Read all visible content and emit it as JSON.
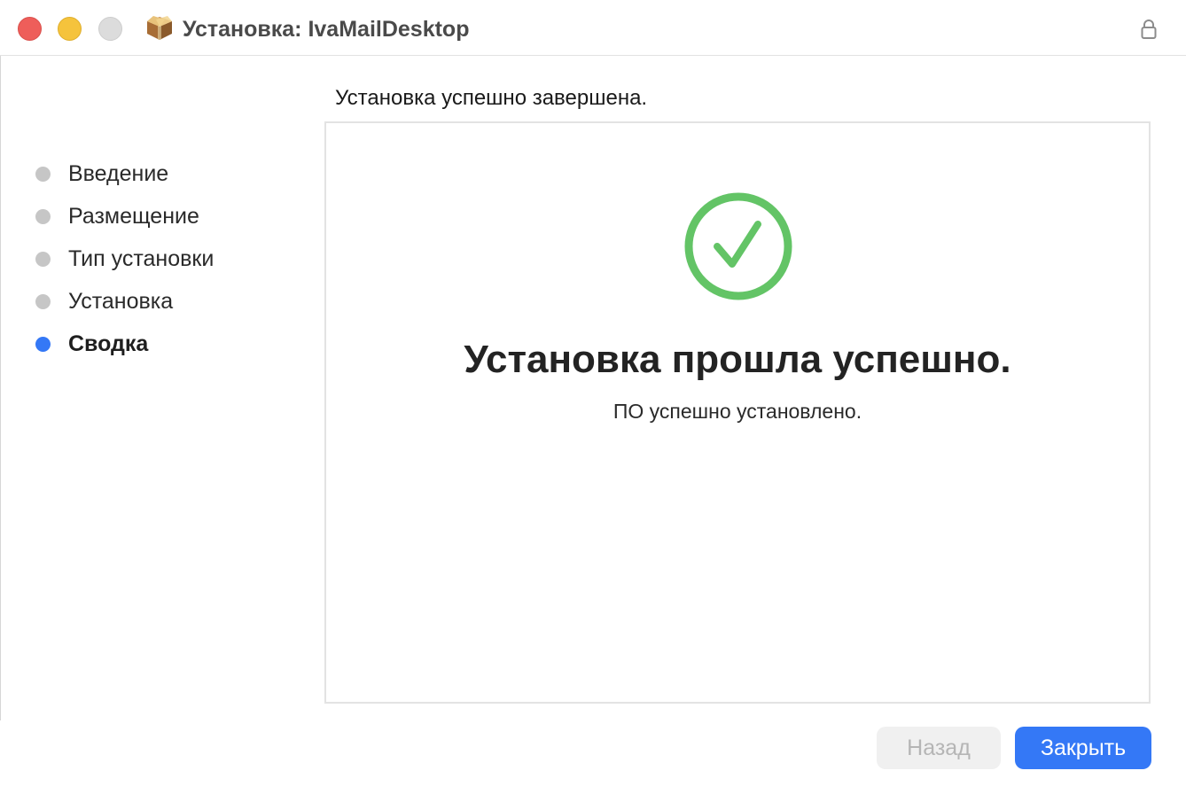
{
  "window": {
    "title": "Установка: IvaMailDesktop"
  },
  "sidebar": {
    "steps": [
      {
        "label": "Введение",
        "active": false
      },
      {
        "label": "Размещение",
        "active": false
      },
      {
        "label": "Тип установки",
        "active": false
      },
      {
        "label": "Установка",
        "active": false
      },
      {
        "label": "Сводка",
        "active": true
      }
    ]
  },
  "content": {
    "header": "Установка успешно завершена.",
    "success_title": "Установка прошла успешно.",
    "success_subtitle": "ПО успешно установлено."
  },
  "buttons": {
    "back_label": "Назад",
    "back_enabled": false,
    "close_label": "Закрыть"
  },
  "icons": {
    "package": "package-icon",
    "lock": "lock-icon",
    "success": "checkmark-circle-icon"
  },
  "colors": {
    "accent": "#3478f6",
    "success": "#63c466",
    "traffic_close": "#ee5e5a",
    "traffic_minimize": "#f5c33c",
    "traffic_zoom_disabled": "#dcdcdc"
  }
}
